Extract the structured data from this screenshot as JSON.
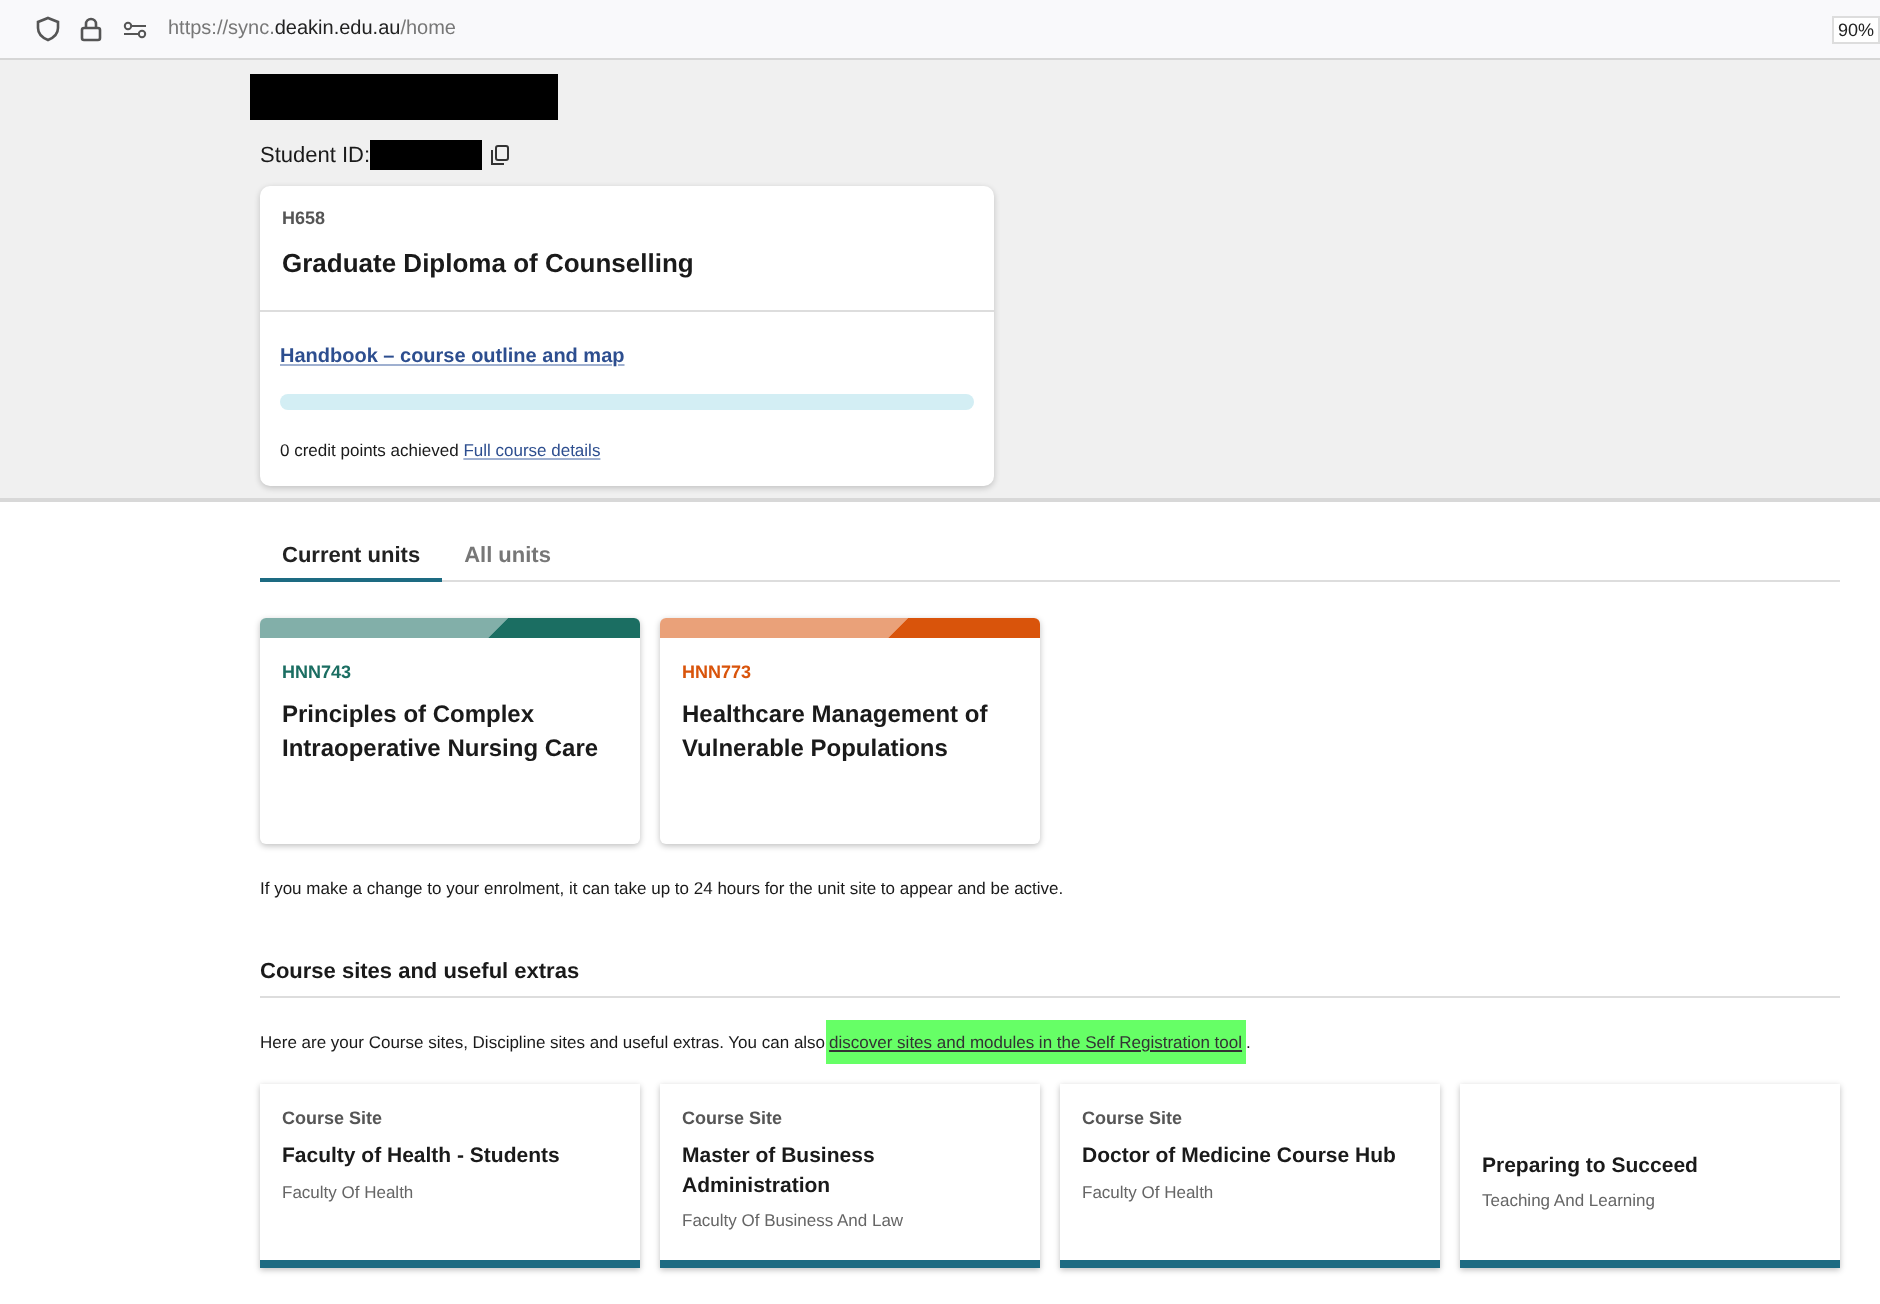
{
  "browser": {
    "url_prefix": "https://sync.",
    "url_domain": "deakin.edu.au",
    "url_path": "/home",
    "zoom": "90%"
  },
  "student": {
    "id_label": "Student ID:"
  },
  "course": {
    "code": "H658",
    "title": "Graduate Diploma of Counselling",
    "handbook_link": "Handbook – course outline and map",
    "level": 0,
    "credit_text": "0 credit points achieved",
    "details_link": "Full course details"
  },
  "tabs": [
    {
      "label": "Current units",
      "selected": true
    },
    {
      "label": "All units",
      "selected": false
    }
  ],
  "units": [
    {
      "code": "HNN743",
      "title": "Principles of Complex Intraoperative Nursing Care",
      "color": "#1b6e62"
    },
    {
      "code": "HNN773",
      "title": "Healthcare Management of Vulnerable Populations",
      "color": "#d9540b"
    }
  ],
  "enrolment_note": "If you make a change to your enrolment, it can take up to 24 hours for the unit site to appear and be active.",
  "extras": {
    "heading": "Course sites and useful extras",
    "intro": "Here are your Course sites, Discipline sites and useful extras. You can also ",
    "link": "discover sites and modules in the Self Registration tool",
    "link_highlighted": true,
    "after": "."
  },
  "sites": [
    {
      "type": "Course Site",
      "title": "Faculty of Health - Students",
      "faculty": "Faculty Of Health"
    },
    {
      "type": "Course Site",
      "title": "Master of Business Administration",
      "faculty": "Faculty Of Business And Law"
    },
    {
      "type": "Course Site",
      "title": "Doctor of Medicine Course Hub",
      "faculty": "Faculty Of Health"
    },
    {
      "title": "Preparing to Succeed",
      "faculty": "Teaching And Learning"
    }
  ]
}
